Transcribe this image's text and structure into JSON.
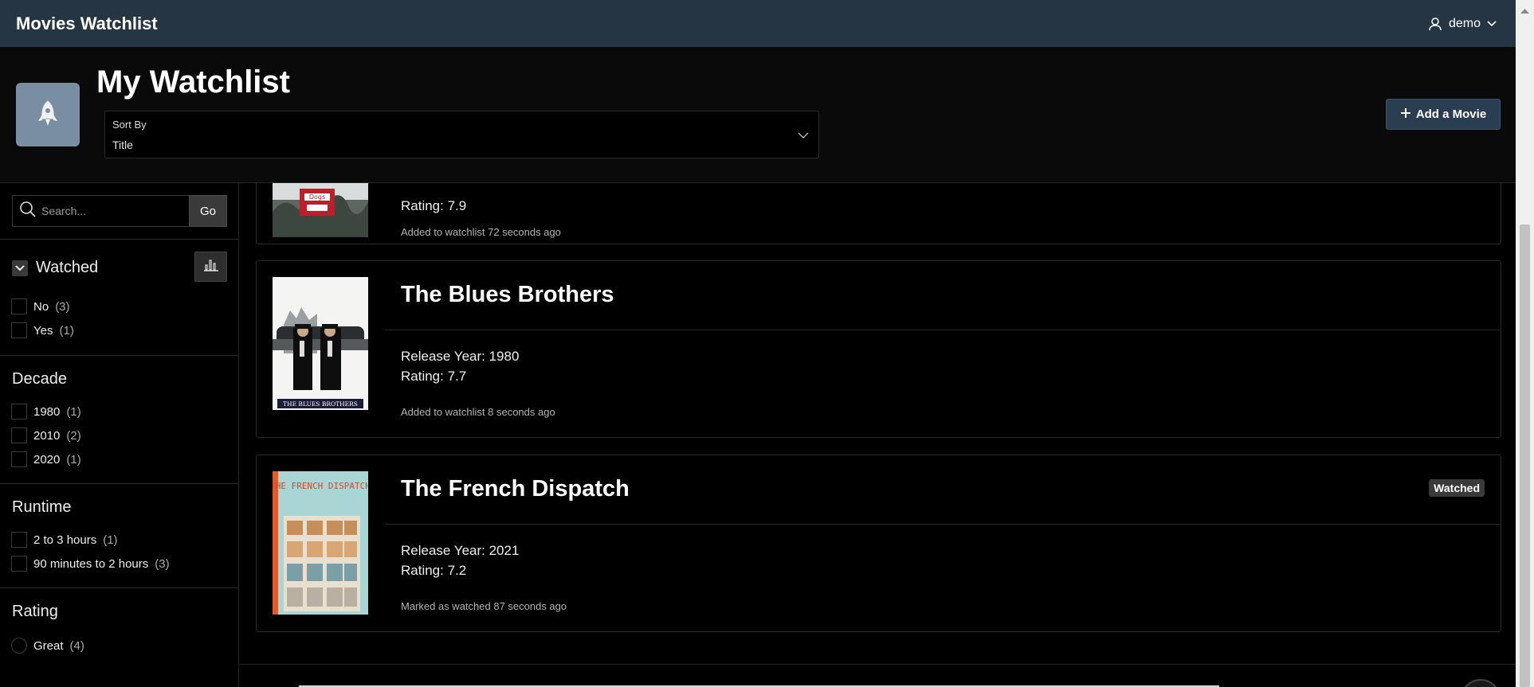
{
  "app": {
    "title": "Movies Watchlist"
  },
  "user": {
    "name": "demo"
  },
  "page": {
    "title": "My Watchlist",
    "add_button": "Add a Movie"
  },
  "sort": {
    "label": "Sort By",
    "value": "Title"
  },
  "search": {
    "placeholder": "Search...",
    "go_label": "Go"
  },
  "facets": {
    "watched": {
      "title": "Watched",
      "options": [
        {
          "label": "No",
          "count": "(3)"
        },
        {
          "label": "Yes",
          "count": "(1)"
        }
      ]
    },
    "decade": {
      "title": "Decade",
      "options": [
        {
          "label": "1980",
          "count": "(1)"
        },
        {
          "label": "2010",
          "count": "(2)"
        },
        {
          "label": "2020",
          "count": "(1)"
        }
      ]
    },
    "runtime": {
      "title": "Runtime",
      "options": [
        {
          "label": "2 to 3 hours",
          "count": "(1)"
        },
        {
          "label": "90 minutes to 2 hours",
          "count": "(3)"
        }
      ]
    },
    "rating": {
      "title": "Rating",
      "options": [
        {
          "label": "Great",
          "count": "(4)"
        }
      ]
    }
  },
  "movies": [
    {
      "title": "",
      "rating": "Rating: 7.9",
      "meta": "Added to watchlist 72 seconds ago",
      "poster_text": "Dogs"
    },
    {
      "title": "The Blues Brothers",
      "release": "Release Year: 1980",
      "rating": "Rating: 7.7",
      "meta": "Added to watchlist 8 seconds ago",
      "poster_text": "THE BLUES BROTHERS"
    },
    {
      "title": "The French Dispatch",
      "release": "Release Year: 2021",
      "rating": "Rating: 7.2",
      "meta": "Marked as watched 87 seconds ago",
      "badge": "Watched",
      "poster_text": "THE FRENCH DISPATCH"
    }
  ],
  "colors": {
    "topbar": "#263544",
    "accent_button": "#2b3d50",
    "page_icon": "#7a8ea3"
  }
}
